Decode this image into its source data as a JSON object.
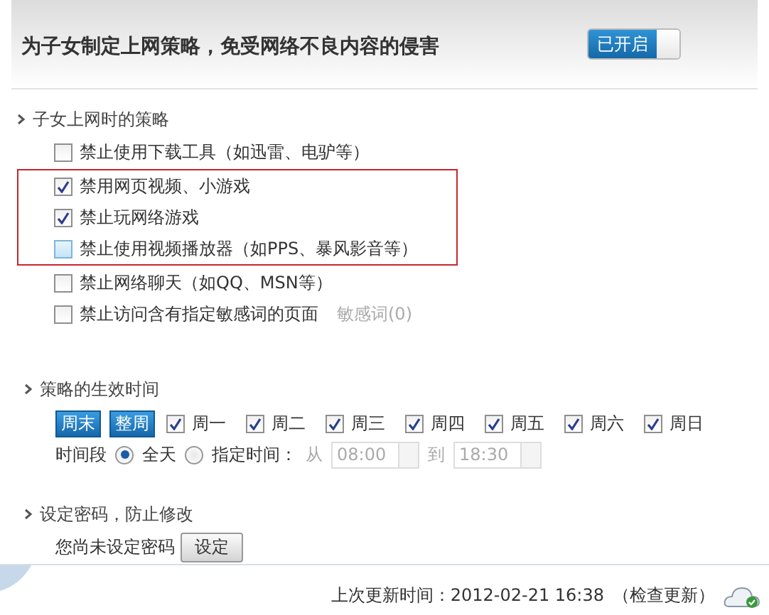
{
  "header": {
    "title": "为子女制定上网策略，免受网络不良内容的侵害",
    "toggle": {
      "label": "已开启",
      "on": true
    }
  },
  "policy": {
    "title": "子女上网时的策略",
    "rules": [
      {
        "label": "禁止使用下载工具（如迅雷、电驴等）",
        "checked": false,
        "highlighted": false,
        "hovered": false
      },
      {
        "label": "禁用网页视频、小游戏",
        "checked": true,
        "highlighted": true,
        "hovered": false
      },
      {
        "label": "禁止玩网络游戏",
        "checked": true,
        "highlighted": true,
        "hovered": false
      },
      {
        "label": "禁止使用视频播放器（如PPS、暴风影音等）",
        "checked": false,
        "highlighted": true,
        "hovered": true
      },
      {
        "label": "禁止网络聊天（如QQ、MSN等）",
        "checked": false,
        "highlighted": false,
        "hovered": false
      },
      {
        "label": "禁止访问含有指定敏感词的页面",
        "checked": false,
        "highlighted": false,
        "hovered": false,
        "link": "敏感词(0)"
      }
    ]
  },
  "schedule": {
    "title": "策略的生效时间",
    "presets": [
      "周末",
      "整周"
    ],
    "days": [
      {
        "label": "周一",
        "checked": true
      },
      {
        "label": "周二",
        "checked": true
      },
      {
        "label": "周三",
        "checked": true
      },
      {
        "label": "周四",
        "checked": true
      },
      {
        "label": "周五",
        "checked": true
      },
      {
        "label": "周六",
        "checked": true
      },
      {
        "label": "周日",
        "checked": true
      }
    ],
    "period_label": "时间段",
    "modes": [
      {
        "label": "全天",
        "selected": true
      },
      {
        "label": "指定时间：",
        "selected": false
      }
    ],
    "from_label": "从",
    "from": "08:00",
    "to_label": "到",
    "to": "18:30"
  },
  "password": {
    "title": "设定密码，防止修改",
    "status": "您尚未设定密码",
    "button": "设定"
  },
  "footer": {
    "last_update": "上次更新时间：2012-02-21 16:38",
    "check_link": "（检查更新）"
  }
}
